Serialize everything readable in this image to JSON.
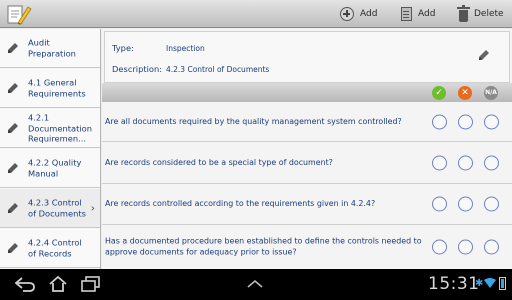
{
  "actionbar": {
    "add_checkpoint_label": "Add",
    "add_document_label": "Add",
    "delete_label": "Delete"
  },
  "sidebar": {
    "items": [
      {
        "label": "Audit Preparation",
        "active": false,
        "chevron": false
      },
      {
        "label": "4.1 General Requirements",
        "active": false,
        "chevron": false
      },
      {
        "label": "4.2.1 Documentation Requiremen...",
        "active": false,
        "chevron": false
      },
      {
        "label": "4.2.2 Quality Manual",
        "active": false,
        "chevron": false
      },
      {
        "label": "4.2.3 Control of Documents",
        "active": true,
        "chevron": true
      },
      {
        "label": "4.2.4 Control of Records",
        "active": false,
        "chevron": false
      }
    ]
  },
  "info": {
    "type_label": "Type:",
    "type_value": "Inspection",
    "description_label": "Description:",
    "description_value": "4.2.3 Control of Documents"
  },
  "answer_header": {
    "ok_icon": "check-icon",
    "no_icon": "cross-icon",
    "na_label": "N/A"
  },
  "questions": [
    {
      "text": "Are all documents required by the quality management system controlled?"
    },
    {
      "text": "Are records considered to be a special type of document?"
    },
    {
      "text": "Are records controlled according to the requirements given in 4.2.4?"
    },
    {
      "text": "Has a documented procedure been established to define the controls needed to approve documents for adequacy prior to issue?"
    }
  ],
  "statusbar": {
    "time": "15:31"
  },
  "colors": {
    "link_text": "#1b3c7a",
    "radio_border": "#6f7fc4",
    "ok_green": "#6cbf2a",
    "no_orange": "#e86a1c",
    "status_blue": "#36a7e8"
  }
}
